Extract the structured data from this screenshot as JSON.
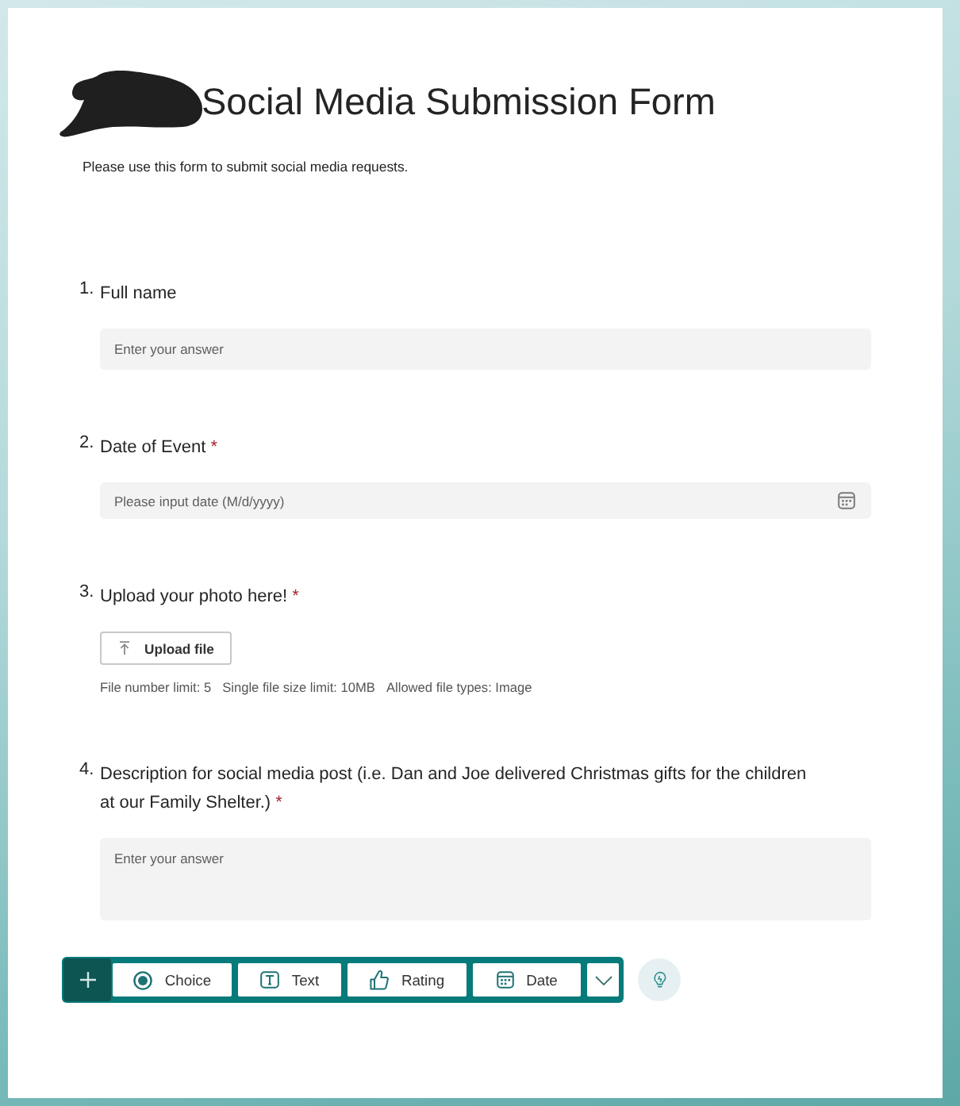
{
  "form": {
    "title": "Social Media Submission Form",
    "description": "Please use this form to submit social media requests."
  },
  "questions": [
    {
      "number": "1.",
      "label": "Full name",
      "kind": "text",
      "placeholder": "Enter your answer"
    },
    {
      "number": "2.",
      "label": "Date of Event",
      "required_mark": "*",
      "kind": "date",
      "placeholder": "Please input date (M/d/yyyy)"
    },
    {
      "number": "3.",
      "label": "Upload your photo here!",
      "required_mark": "*",
      "kind": "upload",
      "button": "Upload file",
      "limits": [
        "File number limit: 5",
        "Single file size limit: 10MB",
        "Allowed file types: Image"
      ]
    },
    {
      "number": "4.",
      "label": "Description for social media post (i.e. Dan and Joe delivered Christmas gifts for the children at our Family Shelter.)",
      "required_mark": "*",
      "kind": "long_text",
      "placeholder": "Enter your answer"
    }
  ],
  "toolbar": {
    "items": [
      {
        "kind": "choice",
        "label": "Choice"
      },
      {
        "kind": "text",
        "label": "Text"
      },
      {
        "kind": "rating",
        "label": "Rating"
      },
      {
        "kind": "date",
        "label": "Date"
      }
    ]
  }
}
